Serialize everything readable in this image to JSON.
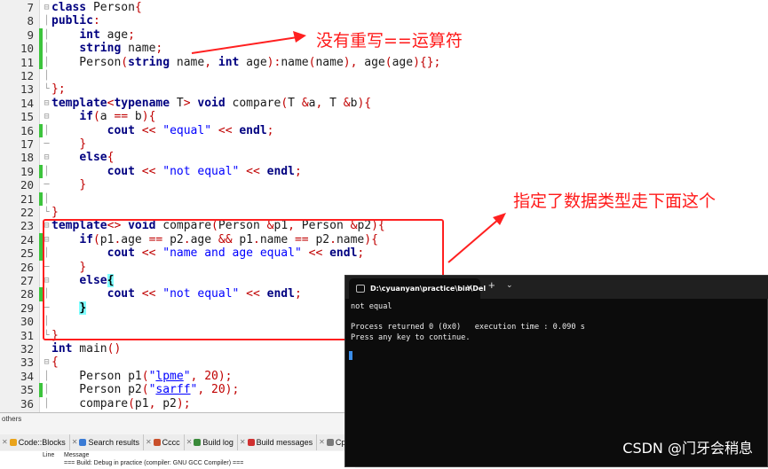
{
  "editor": {
    "lines": [
      {
        "n": "7",
        "html": "<span class=\"kw\">class</span> Person<span class=\"brace\">{</span>",
        "mark": false,
        "fold": "⊟"
      },
      {
        "n": "8",
        "html": "<span class=\"kw\">public</span><span class=\"op\">:</span>",
        "mark": false,
        "fold": "│"
      },
      {
        "n": "9",
        "html": "    <span class=\"typ\">int</span> age<span class=\"op\">;</span>",
        "mark": true,
        "fold": "│"
      },
      {
        "n": "10",
        "html": "    <span class=\"typ\">string</span> name<span class=\"op\">;</span>",
        "mark": true,
        "fold": "│"
      },
      {
        "n": "11",
        "html": "    Person<span class=\"op\">(</span><span class=\"typ\">string</span> name<span class=\"op\">,</span> <span class=\"typ\">int</span> age<span class=\"op\">):</span>name<span class=\"op\">(</span>name<span class=\"op\">),</span> age<span class=\"op\">(</span>age<span class=\"op\">){};</span>",
        "mark": true,
        "fold": "│"
      },
      {
        "n": "12",
        "html": "",
        "mark": false,
        "fold": "│"
      },
      {
        "n": "13",
        "html": "<span class=\"brace\">};</span>",
        "mark": false,
        "fold": "└"
      },
      {
        "n": "14",
        "html": "<span class=\"kw\">template</span><span class=\"op\">&lt;</span><span class=\"kw\">typename</span> T<span class=\"op\">&gt;</span> <span class=\"typ\">void</span> compare<span class=\"op\">(</span>T <span class=\"op\">&amp;</span>a<span class=\"op\">,</span> T <span class=\"op\">&amp;</span>b<span class=\"op\">)</span><span class=\"brace\">{</span>",
        "mark": false,
        "fold": "⊟"
      },
      {
        "n": "15",
        "html": "    <span class=\"kw\">if</span><span class=\"op\">(</span>a <span class=\"op\">==</span> b<span class=\"op\">)</span><span class=\"brace\">{</span>",
        "mark": false,
        "fold": "⊟"
      },
      {
        "n": "16",
        "html": "        <span class=\"kw\">cout</span> <span class=\"op\">&lt;&lt;</span> <span class=\"str\">\"equal\"</span> <span class=\"op\">&lt;&lt;</span> <span class=\"kw\">endl</span><span class=\"op\">;</span>",
        "mark": true,
        "fold": "│"
      },
      {
        "n": "17",
        "html": "    <span class=\"brace\">}</span>",
        "mark": false,
        "fold": "─"
      },
      {
        "n": "18",
        "html": "    <span class=\"kw\">else</span><span class=\"brace\">{</span>",
        "mark": false,
        "fold": "⊟"
      },
      {
        "n": "19",
        "html": "        <span class=\"kw\">cout</span> <span class=\"op\">&lt;&lt;</span> <span class=\"str\">\"not equal\"</span> <span class=\"op\">&lt;&lt;</span> <span class=\"kw\">endl</span><span class=\"op\">;</span>",
        "mark": true,
        "fold": "│"
      },
      {
        "n": "20",
        "html": "    <span class=\"brace\">}</span>",
        "mark": false,
        "fold": "─"
      },
      {
        "n": "21",
        "html": "",
        "mark": true,
        "fold": "│"
      },
      {
        "n": "22",
        "html": "<span class=\"brace\">}</span>",
        "mark": false,
        "fold": "└"
      },
      {
        "n": "23",
        "html": "<span class=\"kw\">template</span><span class=\"op\">&lt;&gt;</span> <span class=\"typ\">void</span> compare<span class=\"op\">(</span>Person <span class=\"op\">&amp;</span>p1<span class=\"op\">,</span> Person <span class=\"op\">&amp;</span>p2<span class=\"op\">)</span><span class=\"brace\">{</span>",
        "mark": false,
        "fold": "⊟"
      },
      {
        "n": "24",
        "html": "    <span class=\"kw\">if</span><span class=\"op\">(</span>p1<span class=\"op\">.</span>age <span class=\"op\">==</span> p2<span class=\"op\">.</span>age <span class=\"op\">&amp;&amp;</span> p1<span class=\"op\">.</span>name <span class=\"op\">==</span> p2<span class=\"op\">.</span>name<span class=\"op\">)</span><span class=\"brace\">{</span>",
        "mark": true,
        "fold": "⊟"
      },
      {
        "n": "25",
        "html": "        <span class=\"kw\">cout</span> <span class=\"op\">&lt;&lt;</span> <span class=\"str\">\"name and age equal\"</span> <span class=\"op\">&lt;&lt;</span> <span class=\"kw\">endl</span><span class=\"op\">;</span>",
        "mark": true,
        "fold": "│"
      },
      {
        "n": "26",
        "html": "    <span class=\"brace\">}</span>",
        "mark": false,
        "fold": "─"
      },
      {
        "n": "27",
        "html": "    <span class=\"kw\">else</span><span class=\"bhl\">{</span>",
        "mark": false,
        "fold": "⊟"
      },
      {
        "n": "28",
        "html": "        <span class=\"kw\">cout</span> <span class=\"op\">&lt;&lt;</span> <span class=\"str\">\"not equal\"</span> <span class=\"op\">&lt;&lt;</span> <span class=\"kw\">endl</span><span class=\"op\">;</span>",
        "mark": true,
        "fold": "│"
      },
      {
        "n": "29",
        "html": "    <span class=\"bhl\">}</span>",
        "mark": false,
        "fold": "─"
      },
      {
        "n": "30",
        "html": "",
        "mark": false,
        "fold": "│"
      },
      {
        "n": "31",
        "html": "<span class=\"brace\">}</span>",
        "mark": false,
        "fold": "└"
      },
      {
        "n": "32",
        "html": "<span class=\"typ\">int</span> main<span class=\"op\">()</span>",
        "mark": false,
        "fold": ""
      },
      {
        "n": "33",
        "html": "<span class=\"brace\">{</span>",
        "mark": false,
        "fold": "⊟"
      },
      {
        "n": "34",
        "html": "    Person p1<span class=\"op\">(</span><span class=\"str\">\"<u>lpme</u>\"</span><span class=\"op\">,</span> <span class=\"op\">20);</span>",
        "mark": false,
        "fold": "│"
      },
      {
        "n": "35",
        "html": "    Person p2<span class=\"op\">(</span><span class=\"str\">\"<u>sarff</u>\"</span><span class=\"op\">,</span> <span class=\"op\">20);</span>",
        "mark": true,
        "fold": "│"
      },
      {
        "n": "36",
        "html": "    compare<span class=\"op\">(</span>p1<span class=\"op\">,</span> p2<span class=\"op\">);</span>",
        "mark": false,
        "fold": "│"
      }
    ]
  },
  "annotations": {
    "top_note": "没有重写==运算符",
    "right_note": "指定了数据类型走下面这个",
    "color": "#ff1a1a"
  },
  "bottom": {
    "others_label": "others",
    "tabs": [
      {
        "label": "Code::Blocks",
        "icon": "codeblocks-icon",
        "color": "#e9a31b"
      },
      {
        "label": "Search results",
        "icon": "search-icon",
        "color": "#3a7bd5"
      },
      {
        "label": "Cccc",
        "icon": "cccc-icon",
        "color": "#c9502b"
      },
      {
        "label": "Build log",
        "icon": "gear-icon",
        "color": "#3a8a3a"
      },
      {
        "label": "Build messages",
        "icon": "build-messages-icon",
        "color": "#d03030"
      },
      {
        "label": "CppCheck",
        "icon": "cppcheck-icon",
        "color": "#7a7a7a"
      }
    ],
    "log_header_line": "Line",
    "log_header_message": "Message",
    "log_message": "=== Build: Debug in practice (compiler: GNU GCC Compiler) ==="
  },
  "terminal": {
    "tab_title": "D:\\cyuanyan\\practice\\bin\\Del",
    "output": "not equal\n\nProcess returned 0 (0x0)   execution time : 0.090 s\nPress any key to continue.",
    "cursor_color": "#3b8eea"
  },
  "watermark": "CSDN @门牙会稍息"
}
